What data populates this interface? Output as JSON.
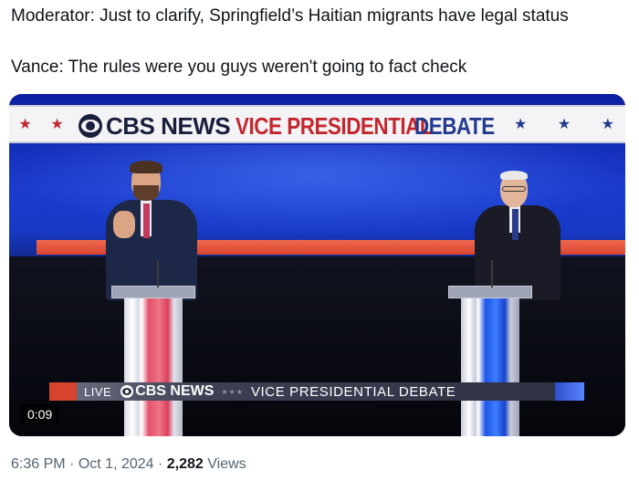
{
  "tweet": {
    "line1": "Moderator: Just to clarify, Springfield’s Haitian migrants have legal status",
    "line2": "Vance: The rules were you guys weren't going to fact check"
  },
  "video": {
    "duration": "0:09",
    "banner": {
      "left_stars": "★  ★",
      "cbs": "CBS NEWS",
      "vp": "VICE PRESIDENTIAL",
      "debate": "DEBATE",
      "right_stars": [
        "★",
        "★",
        "★"
      ]
    },
    "lower_third": {
      "live": "LIVE",
      "cbs": "CBS NEWS",
      "stars": "★★★",
      "title": "VICE PRESIDENTIAL DEBATE"
    }
  },
  "meta": {
    "time": "6:36 PM",
    "sep1": "·",
    "date": "Oct 1, 2024",
    "sep2": "·",
    "views_count": "2,282",
    "views_label": "Views"
  },
  "colors": {
    "brand_red": "#c4262e",
    "brand_blue": "#233a8f",
    "meta_gray": "#536471"
  }
}
